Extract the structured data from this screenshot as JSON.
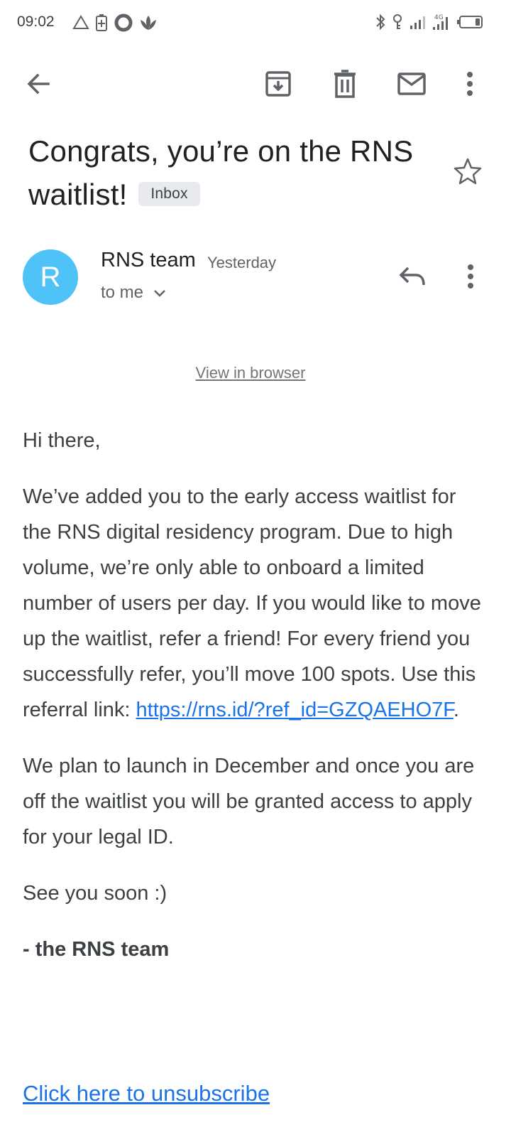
{
  "status_bar": {
    "time": "09:02",
    "network_label": "4G",
    "left_icons": [
      "alert-triangle-icon",
      "battery-saver-icon",
      "ring-icon",
      "lotus-icon"
    ],
    "right_icons": [
      "bluetooth-icon",
      "key-icon",
      "signal-icon",
      "signal-4g-icon",
      "battery-icon"
    ]
  },
  "app_bar": {
    "icons": [
      "back-arrow-icon",
      "archive-icon",
      "delete-icon",
      "mail-icon",
      "more-vert-icon"
    ]
  },
  "email": {
    "subject": "Congrats, you’re on the RNS waitlist!",
    "label": "Inbox",
    "starred": false
  },
  "sender": {
    "avatar_letter": "R",
    "avatar_color": "#4fc3f7",
    "name": "RNS team",
    "date": "Yesterday",
    "recipient": "to me"
  },
  "body": {
    "view_in_browser": "View in browser",
    "greeting": "Hi there,",
    "paragraph1": "We’ve added you to the early access waitlist for the RNS digital residency program. Due to high volume, we’re only able to onboard a limited number of users per day. If you would like to move up the waitlist, refer a friend! For every friend you successfully refer, you’ll move 100 spots. Use this referral link: ",
    "referral_link": "https://rns.id/?ref_id=GZQAEHO7F",
    "paragraph1_end": ".",
    "paragraph2": "We plan to launch in December and once you are off the waitlist you will be granted access to apply for your legal ID.",
    "closing": "See you soon :)",
    "signature": "- the RNS team",
    "unsubscribe": "Click here to unsubscribe"
  },
  "colors": {
    "link": "#1a73e8",
    "chip_bg": "#e8eaed",
    "icon": "#5f6368"
  }
}
